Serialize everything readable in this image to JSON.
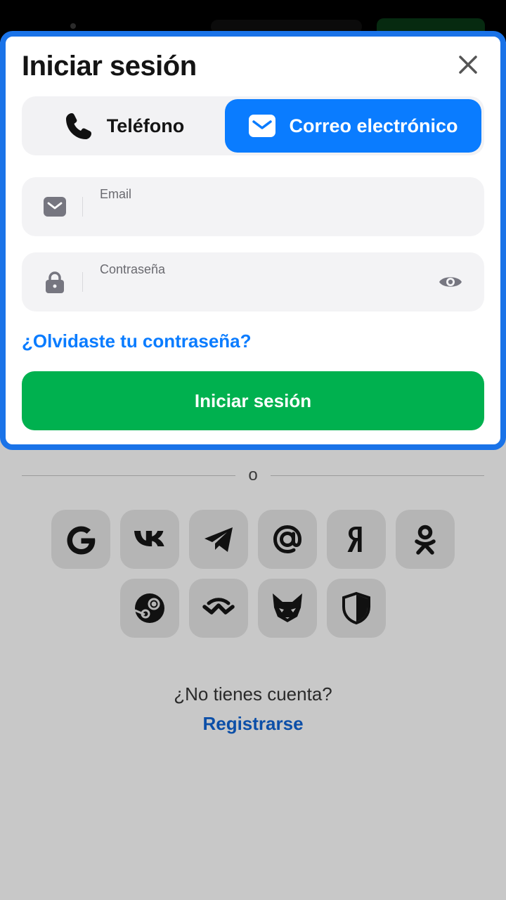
{
  "modal": {
    "title": "Iniciar sesión",
    "close_icon": "close-icon",
    "tabs": [
      {
        "label": "Teléfono",
        "icon": "phone-icon",
        "active": false
      },
      {
        "label": "Correo electrónico",
        "icon": "mail-icon",
        "active": true
      }
    ],
    "email_field": {
      "label": "Email",
      "value": "",
      "icon": "mail-icon"
    },
    "password_field": {
      "label": "Contraseña",
      "value": "",
      "icon": "lock-icon",
      "toggle_icon": "eye-icon"
    },
    "forgot_link": "¿Olvidaste tu contraseña?",
    "submit_label": "Iniciar sesión"
  },
  "divider": {
    "text": "o"
  },
  "social_providers": [
    {
      "name": "google",
      "icon": "google-icon"
    },
    {
      "name": "vk",
      "icon": "vk-icon"
    },
    {
      "name": "telegram",
      "icon": "telegram-icon"
    },
    {
      "name": "mail-ru",
      "icon": "at-icon"
    },
    {
      "name": "yandex",
      "icon": "yandex-icon"
    },
    {
      "name": "odnoklassniki",
      "icon": "ok-icon"
    },
    {
      "name": "steam",
      "icon": "steam-icon"
    },
    {
      "name": "walletconnect",
      "icon": "walletconnect-icon"
    },
    {
      "name": "metamask",
      "icon": "metamask-icon"
    },
    {
      "name": "shield",
      "icon": "shield-icon"
    }
  ],
  "footer": {
    "no_account": "¿No tienes cuenta?",
    "register": "Registrarse"
  },
  "colors": {
    "accent": "#0a7cff",
    "modal_border": "#1a73e8",
    "submit": "#00b14f",
    "register_link": "#0c4fa8",
    "overlay_bg": "#c8c8c8"
  }
}
